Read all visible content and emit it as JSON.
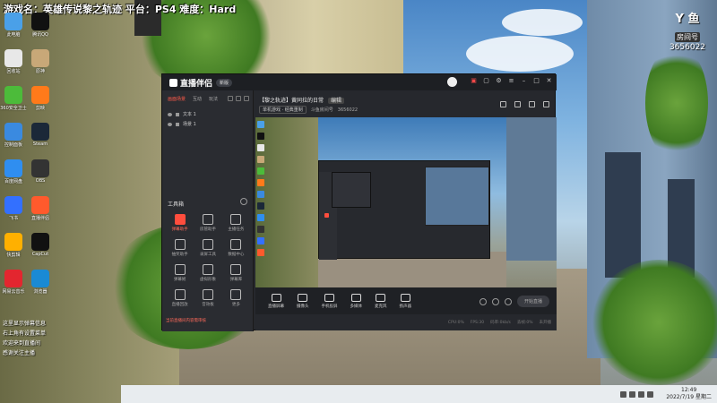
{
  "overlay": {
    "game_info": "游戏名：英雄传说黎之轨迹  平台：PS4  难度：Hard"
  },
  "room_badge": {
    "logo": "Y 鱼",
    "label": "房间号",
    "number": "3656022"
  },
  "desktop_icons": [
    {
      "name": "此电脑",
      "color": "#4aa0e8"
    },
    {
      "name": "腾讯QQ",
      "color": "#111111"
    },
    {
      "name": "回收站",
      "color": "#e8e8e8"
    },
    {
      "name": "原神",
      "color": "#c8a878"
    },
    {
      "name": "360安全卫士",
      "color": "#4cbb3a"
    },
    {
      "name": "剪映",
      "color": "#ff7a1a"
    },
    {
      "name": "控制面板",
      "color": "#3a8ae0"
    },
    {
      "name": "Steam",
      "color": "#1b2838"
    },
    {
      "name": "百度网盘",
      "color": "#2f8ef0"
    },
    {
      "name": "OBS",
      "color": "#333333"
    },
    {
      "name": "飞书",
      "color": "#3370ff"
    },
    {
      "name": "直播伴侣",
      "color": "#ff5a2c"
    },
    {
      "name": "快剪辑",
      "color": "#ffb000"
    },
    {
      "name": "CapCut",
      "color": "#111111"
    },
    {
      "name": "网易云音乐",
      "color": "#e3262f"
    },
    {
      "name": "浏览器",
      "color": "#1a8ad4"
    }
  ],
  "chat": {
    "lines": [
      "这里显示弹幕信息",
      "右上角有设置菜单",
      "欢迎来到直播间",
      "感谢关注主播"
    ]
  },
  "taskbar": {
    "time": "12:49",
    "date": "2022/7/19 星期二"
  },
  "app": {
    "name": "直播伴侣",
    "version_badge": "新版",
    "left_tabs": [
      "画面场景",
      "互动",
      "玩法"
    ],
    "scenes": [
      "文本 1",
      "场景 1"
    ],
    "toolbox_title": "工具箱",
    "tools": [
      {
        "label": "弹幕助手",
        "hot": true
      },
      {
        "label": "房管助手",
        "hot": false
      },
      {
        "label": "主播任务",
        "hot": false
      },
      {
        "label": "抽奖助手",
        "hot": false
      },
      {
        "label": "录屏工具",
        "hot": false
      },
      {
        "label": "数据中心",
        "hot": false
      },
      {
        "label": "弹幕姬",
        "hot": false
      },
      {
        "label": "虚拟形象",
        "hot": false
      },
      {
        "label": "弹幕库",
        "hot": false
      },
      {
        "label": "直播回放",
        "hot": false
      },
      {
        "label": "音效板",
        "hot": false
      },
      {
        "label": "更多",
        "hot": false
      }
    ],
    "alert": "当前直播间内容需审核",
    "stream_title": "【黎之轨迹】黄同拉的日常",
    "stream_title_tag": "编辑",
    "meta_category": "单机游戏 · 经典重制",
    "meta_room_label": "斗鱼房间号",
    "meta_room": "3656022",
    "bottom_buttons": [
      "直播屏幕",
      "摄像头",
      "手机投屏",
      "多媒体",
      "麦克风",
      "扬声器"
    ],
    "go_live": "开始直播",
    "status": [
      "CPU:0%",
      "FPS:30",
      "码率:0kb/s",
      "丢帧:0%",
      "未开播"
    ]
  }
}
